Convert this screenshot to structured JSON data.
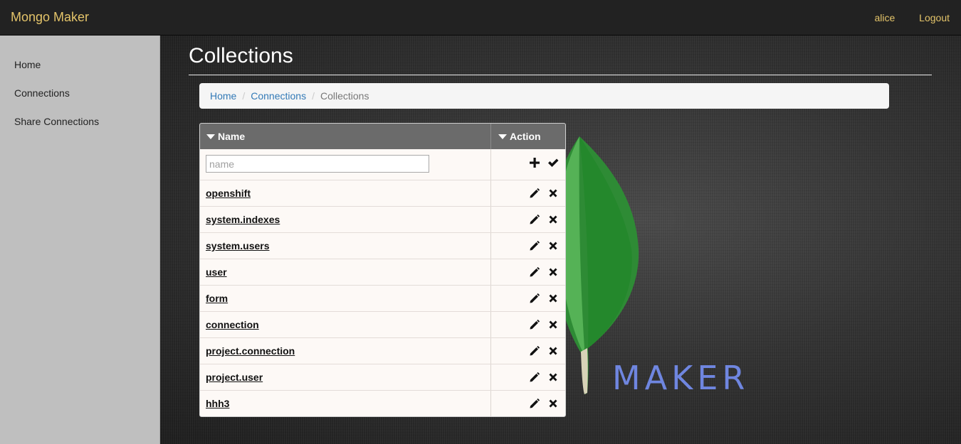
{
  "app": {
    "brand": "Mongo Maker"
  },
  "nav": {
    "user": "alice",
    "logout": "Logout"
  },
  "sidebar": {
    "items": [
      {
        "label": "Home"
      },
      {
        "label": "Connections"
      },
      {
        "label": "Share Connections"
      }
    ]
  },
  "page": {
    "title": "Collections"
  },
  "breadcrumb": {
    "items": [
      {
        "label": "Home"
      },
      {
        "label": "Connections"
      },
      {
        "label": "Collections"
      }
    ],
    "separator": "/"
  },
  "grid": {
    "columns": [
      {
        "label": "Name"
      },
      {
        "label": "Action"
      }
    ],
    "new_row": {
      "placeholder": "name",
      "value": ""
    },
    "rows": [
      {
        "name": "openshift"
      },
      {
        "name": "system.indexes"
      },
      {
        "name": "system.users"
      },
      {
        "name": "user"
      },
      {
        "name": "form"
      },
      {
        "name": "connection"
      },
      {
        "name": "project.connection"
      },
      {
        "name": "project.user"
      },
      {
        "name": "hhh3"
      }
    ]
  },
  "background": {
    "logo_text": "MAKER"
  },
  "colors": {
    "navbar": "#222222",
    "brand": "#e4c46a",
    "sidebar": "#bfbfbf",
    "link": "#337ab7",
    "grid_header": "#6b6b6b",
    "leaf_green": "#3fa037",
    "maker_text": "#6f86e0"
  },
  "icons": {
    "add": "plus-icon",
    "confirm": "check-icon",
    "edit": "pencil-icon",
    "delete": "close-icon",
    "sort": "caret-down-icon"
  }
}
